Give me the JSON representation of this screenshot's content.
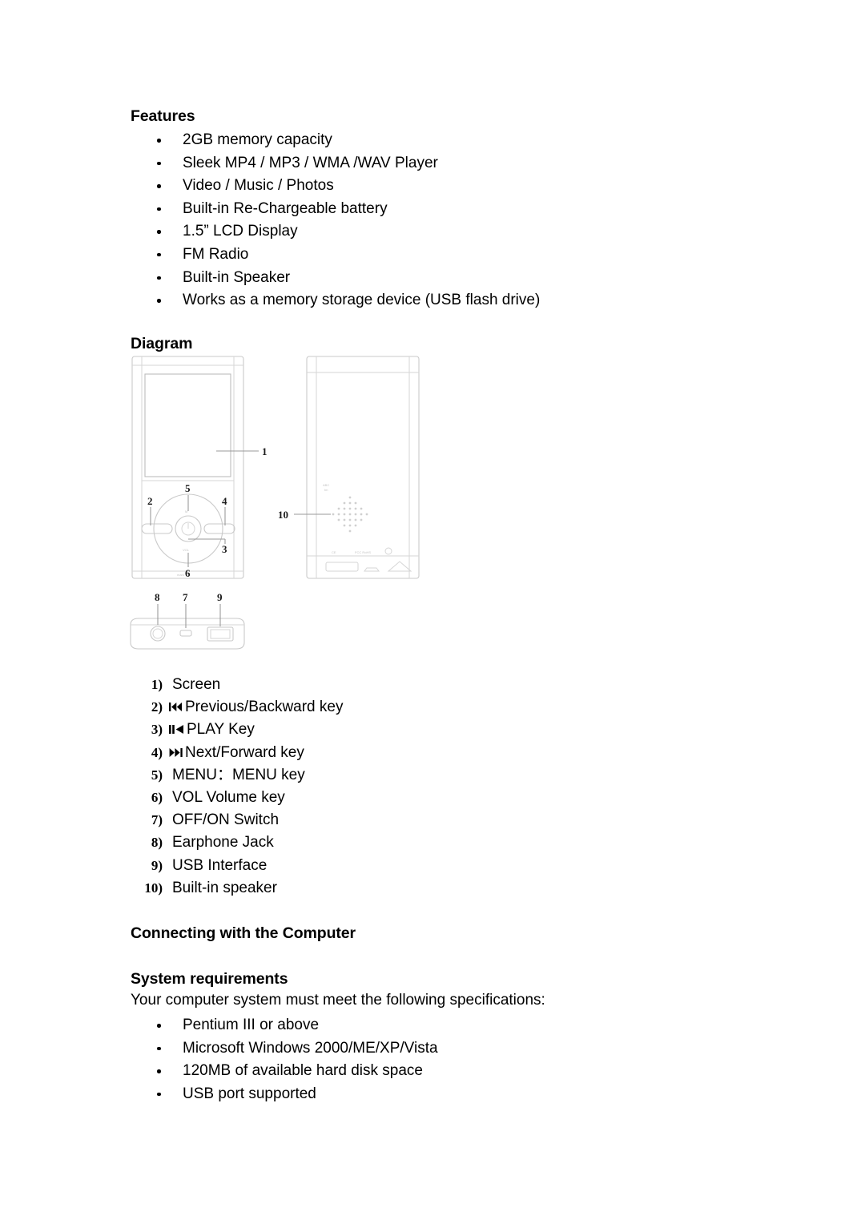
{
  "document": {
    "sections": {
      "features": {
        "heading": "Features",
        "items": [
          "2GB memory capacity",
          "Sleek MP4 / MP3 / WMA /WAV Player",
          "Video / Music / Photos",
          "Built-in Re-Chargeable battery",
          "1.5” LCD Display",
          "FM Radio",
          "Built-in Speaker",
          "Works as a memory storage device (USB flash drive)"
        ]
      },
      "diagram": {
        "heading": "Diagram",
        "callouts": [
          {
            "number": "1",
            "target": "screen"
          },
          {
            "number": "2",
            "target": "previous-key"
          },
          {
            "number": "3",
            "target": "play-key"
          },
          {
            "number": "4",
            "target": "next-key"
          },
          {
            "number": "5",
            "target": "menu-key"
          },
          {
            "number": "6",
            "target": "volume-key"
          },
          {
            "number": "7",
            "target": "off-on-switch"
          },
          {
            "number": "8",
            "target": "earphone-jack"
          },
          {
            "number": "9",
            "target": "usb-interface"
          },
          {
            "number": "10",
            "target": "built-in-speaker"
          }
        ],
        "device_labels": {
          "menu": "M",
          "volume": "VOL",
          "power": "power-symbol"
        },
        "key_list": [
          {
            "number": "1)",
            "icon": "none",
            "label": "Screen"
          },
          {
            "number": "2)",
            "icon": "prev",
            "label": "Previous/Backward key"
          },
          {
            "number": "3)",
            "icon": "pauseplay",
            "label": "PLAY Key"
          },
          {
            "number": "4)",
            "icon": "next",
            "label": "Next/Forward key"
          },
          {
            "number": "5)",
            "icon": "none",
            "label": "MENU：MENU key"
          },
          {
            "number": "6)",
            "icon": "none",
            "label": "VOL Volume key"
          },
          {
            "number": "7)",
            "icon": "none",
            "label": "OFF/ON Switch"
          },
          {
            "number": "8)",
            "icon": "none",
            "label": "Earphone Jack"
          },
          {
            "number": "9)",
            "icon": "none",
            "label": "USB Interface"
          },
          {
            "number": "10)",
            "icon": "none",
            "label": "Built-in speaker"
          }
        ]
      },
      "connecting": {
        "heading": "Connecting with the Computer"
      },
      "system_requirements": {
        "heading": "System requirements",
        "intro": "Your computer system must meet the following specifications:",
        "items": [
          "Pentium III or above",
          "Microsoft Windows 2000/ME/XP/Vista",
          "120MB of available hard disk space",
          "USB port supported"
        ]
      }
    }
  }
}
